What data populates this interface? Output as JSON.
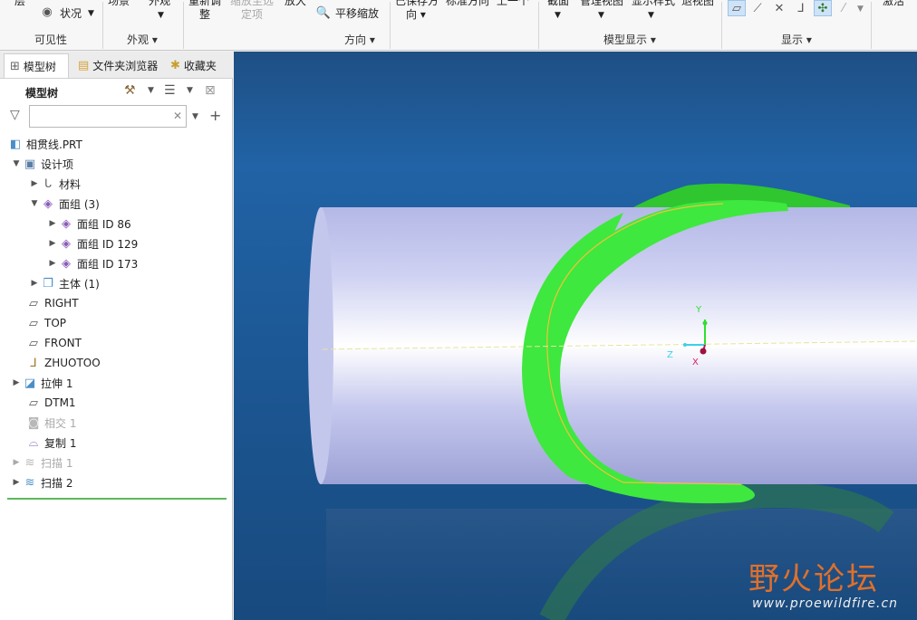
{
  "ribbon": {
    "top_labels": {
      "layer": "层",
      "status": "状况",
      "scene": "场景",
      "appearance": "外观",
      "reorient_1": "重新调",
      "reorient_2": "整",
      "zoom_to_selected_1": "缩放至选",
      "zoom_to_selected_2": "定项",
      "zoom_in": "放大",
      "pan_zoom": "平移缩放",
      "saved_orientations": "已保存方",
      "saved_orientations_2": "向",
      "standard_orientation": "标准方向",
      "previous": "上一个",
      "section": "截面",
      "manage_views": "管理视图",
      "display_style": "显示样式",
      "exploded_view": "退视图",
      "activate": "激活"
    },
    "groups": {
      "visibility": "可见性",
      "appearance": "外观",
      "orientation": "方向",
      "model_display": "模型显示",
      "show": "显示"
    }
  },
  "tabs": {
    "model_tree": "模型树",
    "folder_browser": "文件夹浏览器",
    "favorites": "收藏夹"
  },
  "tree_header": {
    "title": "模型树"
  },
  "filter": {
    "value": "",
    "placeholder": ""
  },
  "tree": {
    "nodes": [
      {
        "label": "相贯线.PRT",
        "icon": "part-icon"
      },
      {
        "label": "设计项",
        "icon": "design-items-icon"
      },
      {
        "label": "材料",
        "icon": "material-icon"
      },
      {
        "label": "面组 (3)",
        "icon": "quilt-icon"
      },
      {
        "label": "面组 ID 86",
        "icon": "quilt-icon"
      },
      {
        "label": "面组 ID 129",
        "icon": "quilt-icon"
      },
      {
        "label": "面组 ID 173",
        "icon": "quilt-icon"
      },
      {
        "label": "主体 (1)",
        "icon": "body-icon"
      },
      {
        "label": "RIGHT",
        "icon": "datum-plane-icon"
      },
      {
        "label": "TOP",
        "icon": "datum-plane-icon"
      },
      {
        "label": "FRONT",
        "icon": "datum-plane-icon"
      },
      {
        "label": "ZHUOTOO",
        "icon": "coordinate-system-icon"
      },
      {
        "label": "拉伸 1",
        "icon": "extrude-icon"
      },
      {
        "label": "DTM1",
        "icon": "datum-plane-icon"
      },
      {
        "label": "相交 1",
        "icon": "intersect-icon"
      },
      {
        "label": "复制 1",
        "icon": "copy-icon"
      },
      {
        "label": "扫描 1",
        "icon": "sweep-icon"
      },
      {
        "label": "扫描 2",
        "icon": "sweep-icon"
      }
    ]
  },
  "viewport": {
    "axis_labels": {
      "y": "Y",
      "z": "Z",
      "x": "X"
    },
    "colors": {
      "background": "#1f5a98",
      "pipe": "#d7daf0",
      "ring": "#3ee83e",
      "intersection_line": "#f2c23a",
      "datum_line": "#e5e5a0"
    }
  },
  "watermark": {
    "title": "野火论坛",
    "url": "www.proewildfire.cn"
  }
}
